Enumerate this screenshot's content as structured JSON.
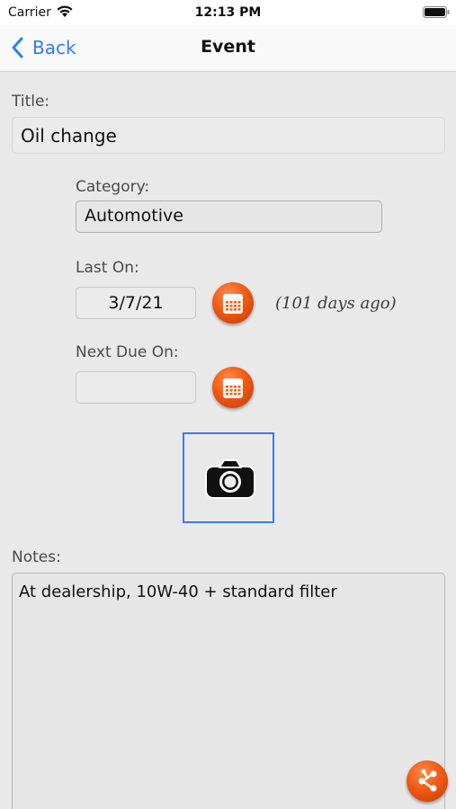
{
  "statusbar": {
    "carrier": "Carrier",
    "time": "12:13 PM"
  },
  "nav": {
    "back_label": "Back",
    "title": "Event"
  },
  "form": {
    "title_label": "Title:",
    "title_value": "Oil change",
    "category_label": "Category:",
    "category_value": "Automotive",
    "last_on_label": "Last On:",
    "last_on_value": "3/7/21",
    "days_ago": "(101 days ago)",
    "next_due_label": "Next Due On:",
    "next_due_value": "",
    "notes_label": "Notes:",
    "notes_value": "At dealership, 10W-40 + standard filter"
  },
  "colors": {
    "accent": "#2e7bf6",
    "button_orange": "#f05a14",
    "photo_border": "#3b7ddd"
  },
  "icons": [
    "wifi-icon",
    "battery-icon",
    "chevron-left-icon",
    "calendar-icon",
    "camera-icon",
    "share-icon"
  ]
}
